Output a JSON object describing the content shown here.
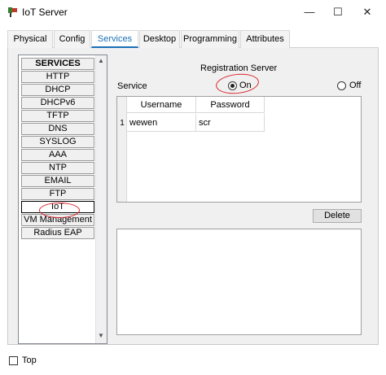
{
  "window": {
    "title": "IoT Server",
    "controls": {
      "minimize": "—",
      "maximize": "☐",
      "close": "✕"
    }
  },
  "tabs": [
    {
      "label": "Physical"
    },
    {
      "label": "Config"
    },
    {
      "label": "Services"
    },
    {
      "label": "Desktop"
    },
    {
      "label": "Programming"
    },
    {
      "label": "Attributes"
    }
  ],
  "active_tab": "Services",
  "services": {
    "header": "SERVICES",
    "items": [
      "HTTP",
      "DHCP",
      "DHCPv6",
      "TFTP",
      "DNS",
      "SYSLOG",
      "AAA",
      "NTP",
      "EMAIL",
      "FTP",
      "IoT",
      "VM Management",
      "Radius EAP"
    ],
    "selected": "IoT"
  },
  "registration": {
    "title": "Registration Server",
    "service_label": "Service",
    "on_label": "On",
    "off_label": "Off",
    "selected": "On"
  },
  "table": {
    "columns": [
      "Username",
      "Password"
    ],
    "rows": [
      {
        "num": "1",
        "username": "wewen",
        "password": "scr"
      }
    ]
  },
  "delete_label": "Delete",
  "top_checkbox": {
    "label": "Top",
    "checked": false
  },
  "colors": {
    "accent": "#1a6fb5",
    "annotation": "#d9262b"
  }
}
